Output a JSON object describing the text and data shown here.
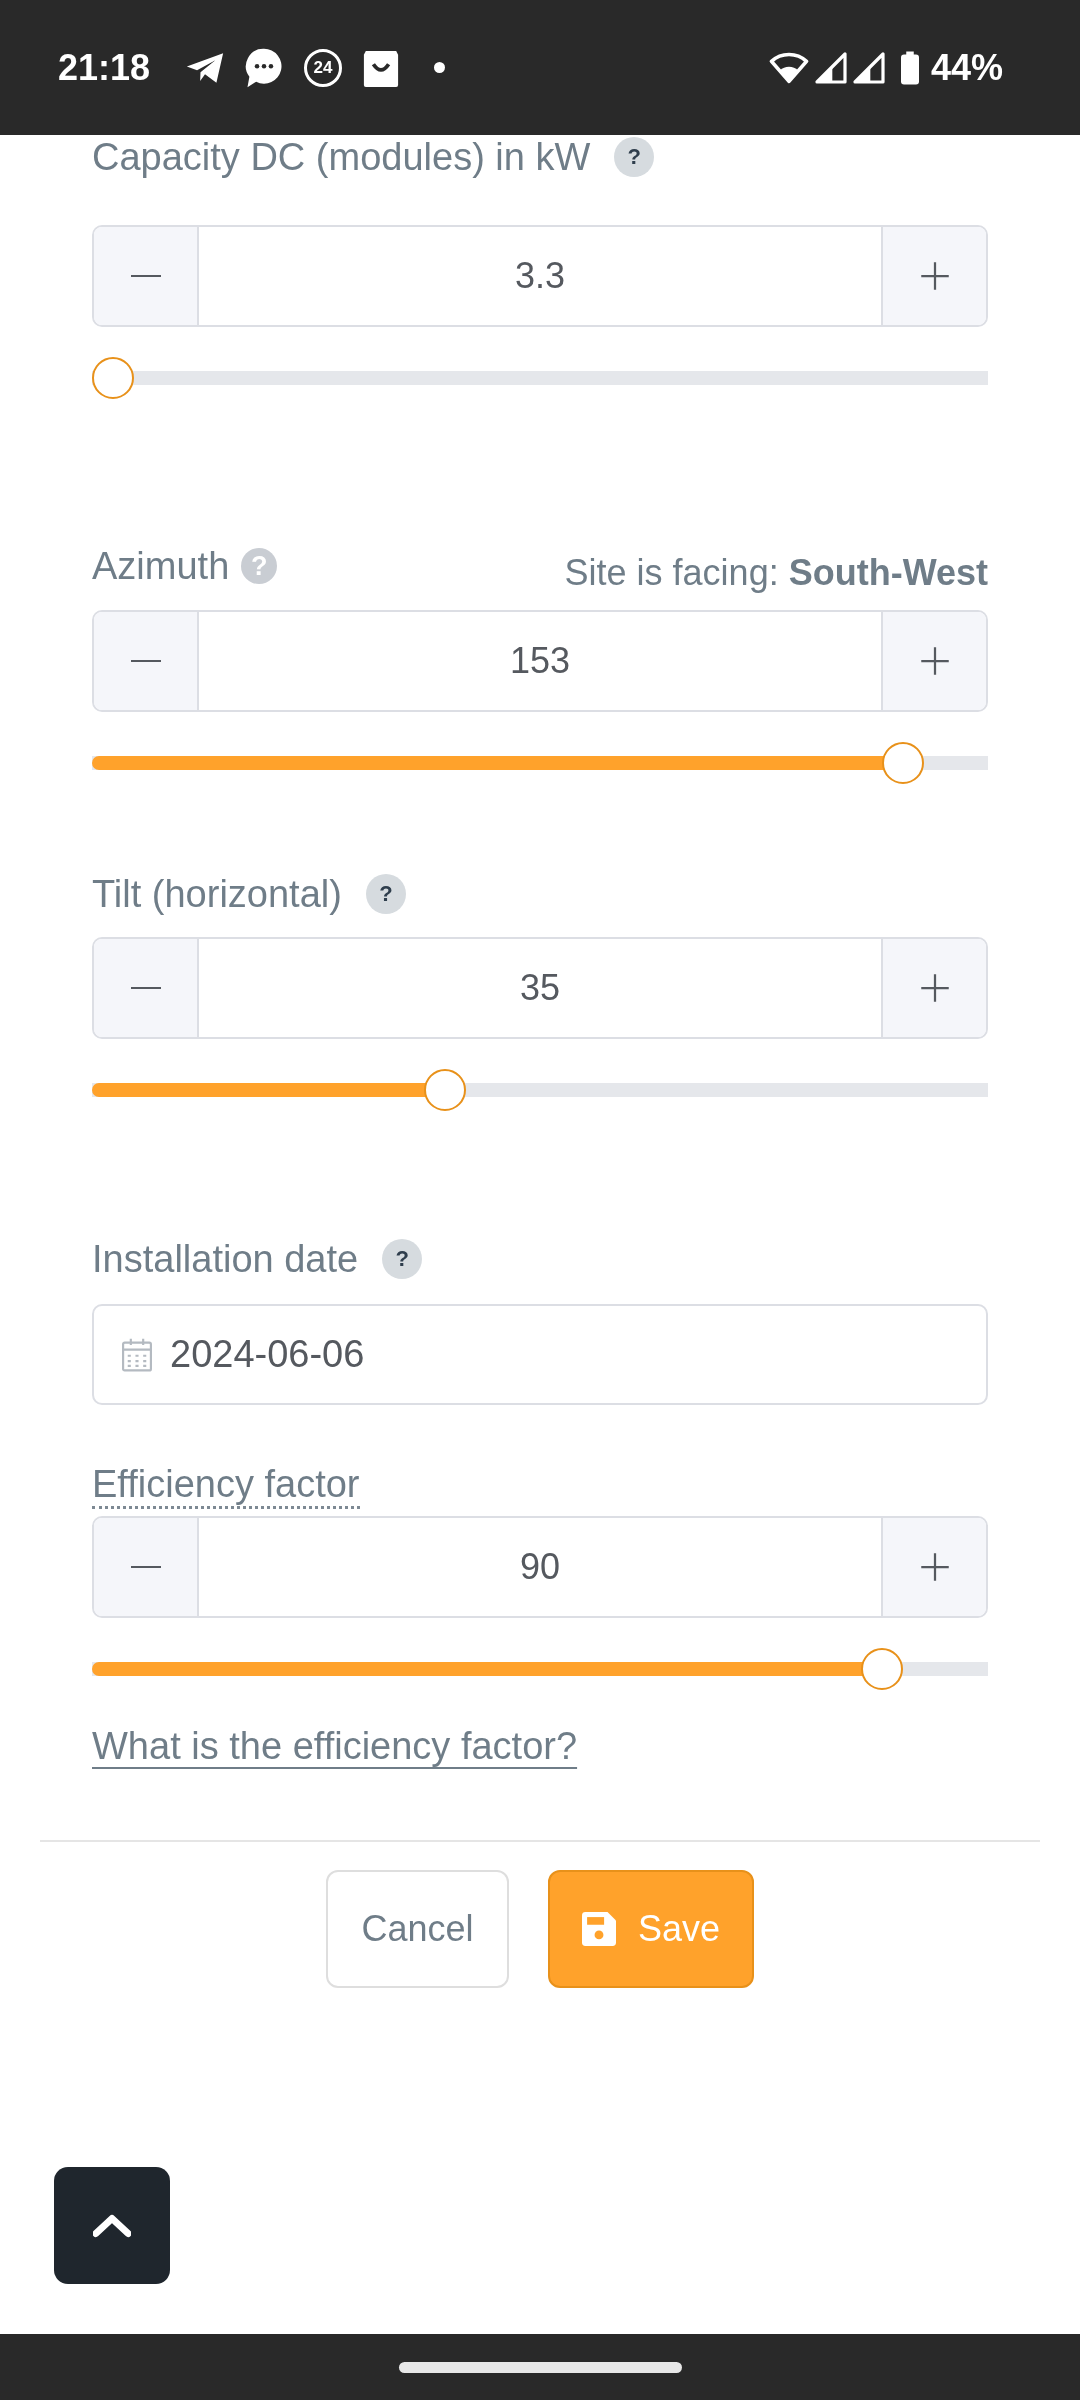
{
  "status_bar": {
    "time": "21:18",
    "badge": "24",
    "battery": "44%"
  },
  "fields": [
    {
      "kind": "stepper",
      "label": "Capacity DC (modules) in kW",
      "tooltip": false,
      "help": {
        "kind": "badge",
        "text": "?"
      },
      "value": "3.3",
      "level": 0
    },
    {
      "kind": "stepper",
      "label": "Azimuth",
      "tooltip": false,
      "help": {
        "kind": "icon",
        "text": "?"
      },
      "facing": "Site is facing: **South-West**",
      "value": "153",
      "level": 0.925
    },
    {
      "kind": "stepper",
      "label": "Tilt (horizontal)",
      "tooltip": false,
      "help": {
        "kind": "badge",
        "text": "?"
      },
      "value": "35",
      "level": 0.389
    },
    {
      "kind": "date",
      "label": "Installation date",
      "tooltip": false,
      "help": {
        "kind": "badge",
        "text": "?"
      },
      "value": "2024-06-06"
    },
    {
      "kind": "stepper",
      "label": "Efficiency factor",
      "tooltip": true,
      "value": "90",
      "level": 0.9,
      "link": "What is the efficiency factor?"
    }
  ],
  "buttons": [
    {
      "kind": "secondary",
      "label": "Cancel"
    },
    {
      "kind": "primary",
      "label": "Save"
    }
  ]
}
